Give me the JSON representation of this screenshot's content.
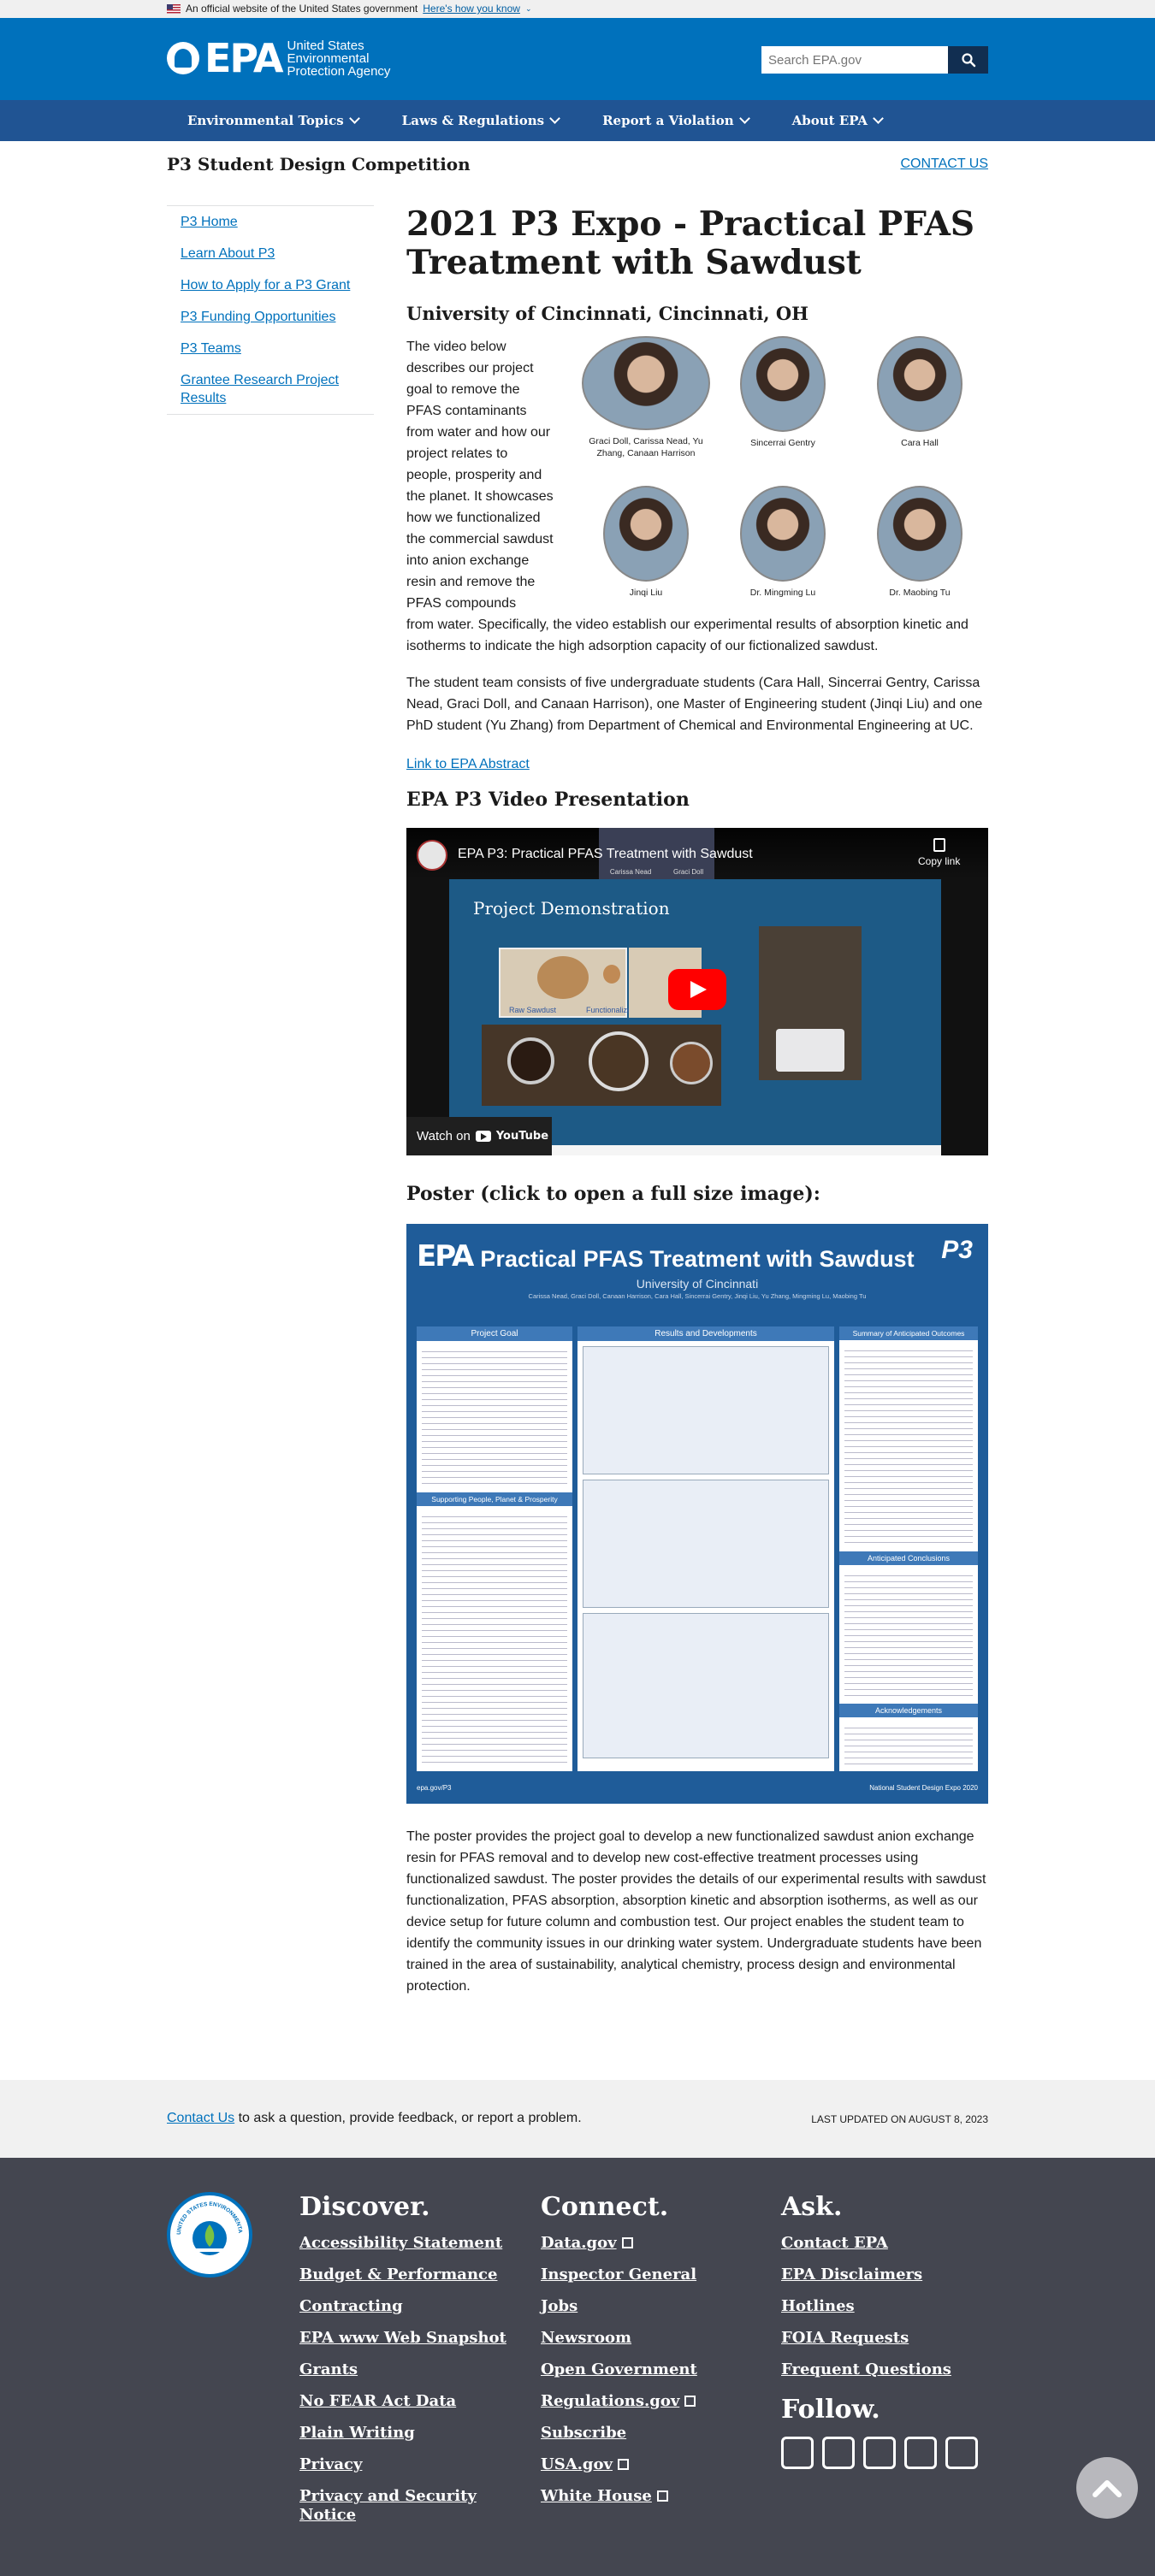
{
  "gov_banner": {
    "text": "An official website of the United States government",
    "link": "Here's how you know"
  },
  "header": {
    "logo": "EPA",
    "agency": "United States Environmental Protection Agency",
    "search_placeholder": "Search EPA.gov"
  },
  "nav": [
    "Environmental Topics",
    "Laws & Regulations",
    "Report a Violation",
    "About EPA"
  ],
  "site_title": "P3 Student Design Competition",
  "contact_top": "CONTACT US",
  "sidebar": [
    "P3 Home",
    "Learn About P3",
    "How to Apply for a P3 Grant",
    "P3 Funding Opportunities",
    "P3 Teams",
    "Grantee Research Project Results"
  ],
  "main": {
    "title": "2021 P3 Expo - Practical PFAS Treatment with Sawdust",
    "subtitle": "University of Cincinnati, Cincinnati, OH",
    "intro": "The video below describes our project goal to remove the PFAS contaminants from water and how our project relates to people, prosperity and the planet. It showcases how we functionalized the commercial sawdust into anion exchange resin and remove the PFAS compounds from water. Specifically, the video establish our experimental results of absorption kinetic and isotherms to indicate the high adsorption capacity of our fictionalized sawdust.",
    "intro_short": "The video below describes our project goal to remove the PFAS contaminants from water and how our project relates to people, prosperity and the planet. It showcases how we functionalized the commercial sawdust into anion exchange resin and remove the PFAS compounds",
    "intro_rest": "from water. Specifically, the video establish our experimental results of absorption kinetic and isotherms to indicate the high adsorption capacity of our fictionalized sawdust.",
    "team_para": "The student team consists of five undergraduate students (Cara Hall, Sincerrai Gentry, Carissa Nead, Graci Doll, and Canaan Harrison), one Master of Engineering student (Jinqi Liu) and one PhD student (Yu Zhang) from Department of Chemical and Environmental Engineering at UC.",
    "abstract_link": "Link to EPA Abstract",
    "video_heading": "EPA P3 Video Presentation",
    "poster_heading": "Poster (click to open a full size image):",
    "poster_para": "The poster provides the project goal to develop a new functionalized sawdust anion exchange resin for PFAS removal and to develop new cost-effective treatment processes using functionalized sawdust. The poster provides the details of our experimental results with sawdust functionalization, PFAS absorption, absorption kinetic and absorption isotherms, as well as our device setup for future column and combustion test. Our project enables the student team to identify the community issues in our drinking water system. Undergraduate students have been trained in the area of sustainability, analytical chemistry, process design and environmental protection."
  },
  "team_photos": [
    {
      "name": "Graci Doll, Carissa Nead, Yu Zhang, Canaan Harrison"
    },
    {
      "name": "Sincerrai Gentry"
    },
    {
      "name": "Cara Hall"
    },
    {
      "name": "Jinqi Liu"
    },
    {
      "name": "Dr. Mingming Lu"
    },
    {
      "name": "Dr. Maobing Tu"
    }
  ],
  "video": {
    "title": "EPA P3: Practical PFAS Treatment with Sawdust",
    "copy_link": "Copy link",
    "slide_title": "Project Demonstration",
    "raw_sawdust": "Raw Sawdust",
    "functionalized": "Functionalized",
    "watch_on": "Watch on",
    "youtube": "YouTube",
    "thumb_names": [
      "Carissa Nead",
      "Graci Doll"
    ]
  },
  "poster": {
    "title": "Practical PFAS Treatment with Sawdust",
    "university": "University of Cincinnati",
    "authors": "Carissa Nead, Graci Doll, Canaan Harrison, Cara Hall, Sincerrai Gentry, Jinqi Liu, Yu Zhang, Mingming Lu, Maobing Tu",
    "col1": "Project Goal",
    "col2": "Results and Developments",
    "col3": "Summary of Anticipated Outcomes",
    "col1b": "Supporting People, Planet & Prosperity",
    "col3b": "Anticipated Conclusions",
    "col3c": "Acknowledgements",
    "footer_left": "epa.gov/P3",
    "footer_right": "National Student Design Expo 2020",
    "logo": "EPA",
    "p3": "P3"
  },
  "footer_bar": {
    "contact_link": "Contact Us",
    "contact_text": " to ask a question, provide feedback, or report a problem.",
    "updated": "LAST UPDATED ON AUGUST 8, 2023"
  },
  "footer": {
    "discover_title": "Discover.",
    "discover": [
      "Accessibility Statement",
      "Budget & Performance",
      "Contracting",
      "EPA www Web Snapshot",
      "Grants",
      "No FEAR Act Data",
      "Plain Writing",
      "Privacy",
      "Privacy and Security Notice"
    ],
    "connect_title": "Connect.",
    "connect": [
      "Data.gov",
      "Inspector General",
      "Jobs",
      "Newsroom",
      "Open Government",
      "Regulations.gov",
      "Subscribe",
      "USA.gov",
      "White House"
    ],
    "connect_external": [
      true,
      false,
      false,
      false,
      false,
      true,
      false,
      true,
      true
    ],
    "ask_title": "Ask.",
    "ask": [
      "Contact EPA",
      "EPA Disclaimers",
      "Hotlines",
      "FOIA Requests",
      "Frequent Questions"
    ],
    "follow_title": "Follow.",
    "social": [
      "facebook-icon",
      "twitter-icon",
      "youtube-icon",
      "flickr-icon",
      "instagram-icon"
    ],
    "seal_text": "UNITED STATES ENVIRONMENTAL PROTECTION"
  }
}
